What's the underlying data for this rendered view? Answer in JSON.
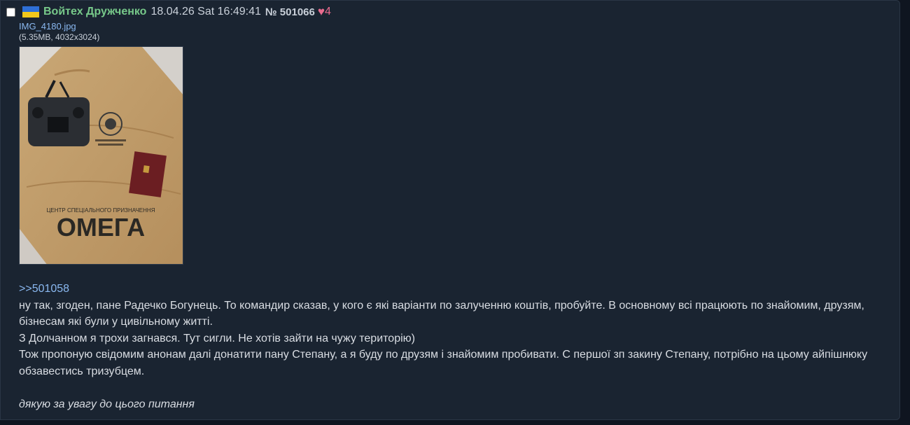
{
  "post": {
    "author": "Войтех Дружченко",
    "datetime": "18.04.26 Sat 16:49:41",
    "number": "№ 501066",
    "likes": "4",
    "flag_colors": {
      "top": "#2e6fd6",
      "bottom": "#f2c81b"
    },
    "heart_icon": "heart-icon",
    "file": {
      "name": "IMG_4180.jpg",
      "meta": "(5.35MB, 4032x3024)"
    },
    "image_text": {
      "shirt_small": "ЦЕНТР СПЕЦІАЛЬНОГО ПРИЗНАЧЕННЯ",
      "shirt_big": "ОМЕГА"
    },
    "reply_to": ">>501058",
    "lines": [
      "ну так, згоден, пане Радечко Богунець. То командир сказав, у кого є які варіанти по залученню коштів, пробуйте. В основному всі працюють по знайомим, друзям, бізнесам які були у цивільному житті.",
      "З Долчанном я трохи загнався. Тут сигли. Не хотів зайти на чужу територію)",
      "Тож пропоную свідомим анонам далі донатити пану Степану, а я буду по друзям і знайомим пробивати. С першої зп закину Степану, потрібно на цьому айпішнюку обзавестись тризубцем."
    ],
    "closing": "дякую за увагу до цього питання"
  }
}
